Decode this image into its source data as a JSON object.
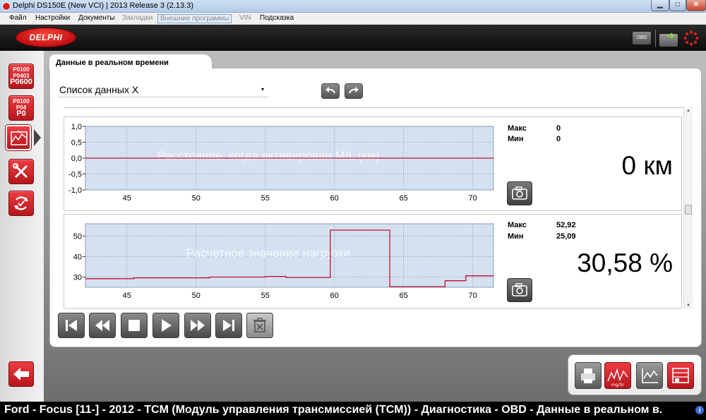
{
  "window": {
    "title": "Delphi DS150E (New VCI) | 2013 Release 3 (2.13.3)",
    "min_glyph": "▁",
    "max_glyph": "□",
    "close_glyph": "✕"
  },
  "menu": [
    {
      "label": "Файл",
      "state": "normal"
    },
    {
      "label": "Настройки",
      "state": "normal"
    },
    {
      "label": "Документы",
      "state": "normal"
    },
    {
      "label": "Закладки",
      "state": "disabled"
    },
    {
      "label": "Внешние программы",
      "state": "active"
    },
    {
      "label": "VIN",
      "state": "disabled"
    },
    {
      "label": "Подсказка",
      "state": "normal"
    }
  ],
  "header": {
    "logo_text": "DELPHI",
    "obd_label": "OBD"
  },
  "sidebar": {
    "dtc_codes_1": [
      "P0100",
      "P0403",
      "P0600"
    ],
    "dtc_codes_2": [
      "P0100",
      "P04",
      "P0"
    ]
  },
  "page": {
    "tab_title": "Данные в реальном времени",
    "dropdown_value": "Список данных X",
    "dropdown_caret": "▾"
  },
  "graphs": [
    {
      "title": "Расстояние, когда активирован MIL (км)",
      "max_label": "Макс",
      "min_label": "Мин",
      "max_value": "0",
      "min_value": "0",
      "current_value": "0 км",
      "y_ticks": [
        "1,0",
        "0,5",
        "0,0",
        "-0,5",
        "-1,0"
      ],
      "x_ticks": [
        "45",
        "50",
        "55",
        "60",
        "65",
        "70"
      ]
    },
    {
      "title": "Расчетное значение нагрузки",
      "max_label": "Макс",
      "min_label": "Мин",
      "max_value": "52,92",
      "min_value": "25,09",
      "current_value": "30,58 %",
      "y_ticks": [
        "50",
        "40",
        "30"
      ],
      "x_ticks": [
        "45",
        "50",
        "55",
        "60",
        "65",
        "70"
      ]
    }
  ],
  "chart_data": [
    {
      "type": "line",
      "title": "Расстояние, когда активирован MIL (км)",
      "xlim": [
        42,
        71.5
      ],
      "ylim": [
        -1.0,
        1.0
      ],
      "x_ticks": [
        45,
        50,
        55,
        60,
        65,
        70
      ],
      "y_ticks": [
        1.0,
        0.5,
        0.0,
        -0.5,
        -1.0
      ],
      "grid": true,
      "series": [
        {
          "color": "#c8102e",
          "x": [
            42,
            71.5
          ],
          "y": [
            0,
            0
          ]
        }
      ]
    },
    {
      "type": "line",
      "title": "Расчетное значение нагрузки",
      "xlim": [
        42,
        71.5
      ],
      "ylim": [
        25,
        56
      ],
      "x_ticks": [
        45,
        50,
        55,
        60,
        65,
        70
      ],
      "y_ticks": [
        50,
        40,
        30
      ],
      "grid": true,
      "series": [
        {
          "color": "#c8102e",
          "x": [
            42,
            45.5,
            45.5,
            51,
            51,
            55,
            55,
            56.5,
            56.5,
            59.7,
            59.7,
            64,
            64,
            68,
            68,
            69.5,
            69.5,
            71.5
          ],
          "y": [
            29.2,
            29.2,
            29.6,
            29.6,
            30.0,
            30.0,
            30.3,
            30.3,
            29.8,
            29.8,
            52.9,
            52.9,
            25.3,
            25.3,
            28.2,
            28.2,
            30.6,
            30.6
          ]
        }
      ]
    }
  ],
  "playback": [
    "skip-to-start",
    "rewind",
    "stop",
    "play",
    "fast-forward",
    "skip-to-end",
    "clear"
  ],
  "status_text": "Ford - Focus [11-] - 2012 - TCM (Модуль управления трансмиссией (TCM)) - Диагностика - OBD - Данные в реальном в.",
  "info_icon": "i",
  "colors": {
    "brand_red": "#d21f26",
    "plot_bg": "#d4e1f1",
    "trace": "#c8102e"
  }
}
